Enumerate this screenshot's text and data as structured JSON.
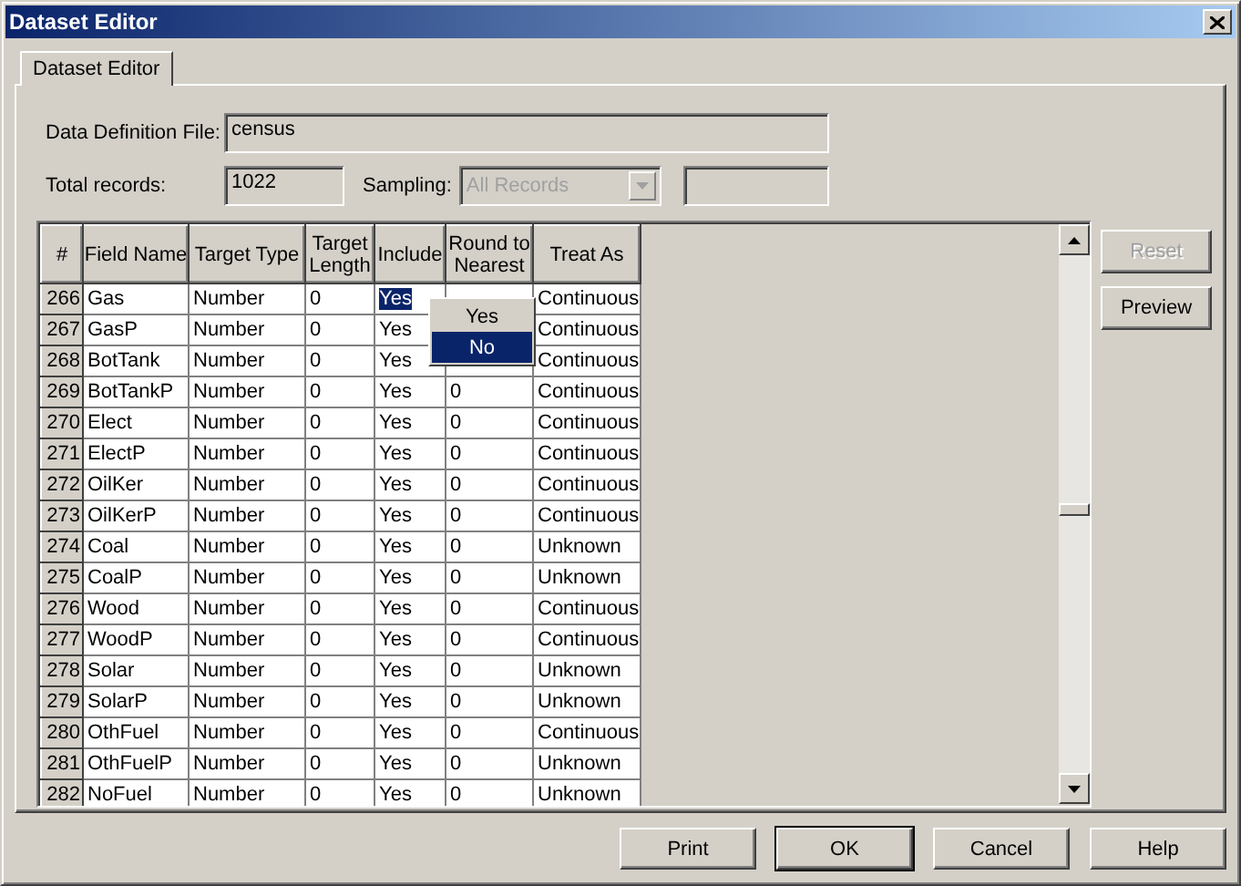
{
  "window": {
    "title": "Dataset Editor"
  },
  "tabs": [
    {
      "label": "Dataset Editor",
      "selected": true
    }
  ],
  "data_definition_file": {
    "label": "Data Definition File:",
    "value": "census"
  },
  "total_records": {
    "label": "Total records:",
    "value": "1022"
  },
  "sampling": {
    "label": "Sampling:",
    "value": "All Records",
    "disabled": true
  },
  "table": {
    "columns": [
      "#",
      "Field Name",
      "Target Type",
      "Target Length",
      "Include",
      "Round to Nearest",
      "Treat As"
    ],
    "rows": [
      {
        "number": "266",
        "field_name": "Gas",
        "target_type": "Number",
        "target_length": "0",
        "include": "Yes",
        "treat_as": "Continuous",
        "editing": true
      },
      {
        "number": "267",
        "field_name": "GasP",
        "target_type": "Number",
        "target_length": "0",
        "include": "Yes",
        "treat_as": "Continuous",
        "editing": false
      },
      {
        "number": "268",
        "field_name": "BotTank",
        "target_type": "Number",
        "target_length": "0",
        "include": "Yes",
        "treat_as": "Continuous",
        "editing": false
      },
      {
        "number": "269",
        "field_name": "BotTankP",
        "target_type": "Number",
        "target_length": "0",
        "include": "Yes",
        "round_to_nearest": "0",
        "treat_as": "Continuous",
        "editing": false
      },
      {
        "number": "270",
        "field_name": "Elect",
        "target_type": "Number",
        "target_length": "0",
        "include": "Yes",
        "round_to_nearest": "0",
        "treat_as": "Continuous",
        "editing": false
      },
      {
        "number": "271",
        "field_name": "ElectP",
        "target_type": "Number",
        "target_length": "0",
        "include": "Yes",
        "round_to_nearest": "0",
        "treat_as": "Continuous",
        "editing": false
      },
      {
        "number": "272",
        "field_name": "OilKer",
        "target_type": "Number",
        "target_length": "0",
        "include": "Yes",
        "round_to_nearest": "0",
        "treat_as": "Continuous",
        "editing": false
      },
      {
        "number": "273",
        "field_name": "OilKerP",
        "target_type": "Number",
        "target_length": "0",
        "include": "Yes",
        "round_to_nearest": "0",
        "treat_as": "Continuous",
        "editing": false
      },
      {
        "number": "274",
        "field_name": "Coal",
        "target_type": "Number",
        "target_length": "0",
        "include": "Yes",
        "round_to_nearest": "0",
        "treat_as": "Unknown",
        "editing": false
      },
      {
        "number": "275",
        "field_name": "CoalP",
        "target_type": "Number",
        "target_length": "0",
        "include": "Yes",
        "round_to_nearest": "0",
        "treat_as": "Unknown",
        "editing": false
      },
      {
        "number": "276",
        "field_name": "Wood",
        "target_type": "Number",
        "target_length": "0",
        "include": "Yes",
        "round_to_nearest": "0",
        "treat_as": "Continuous",
        "editing": false
      },
      {
        "number": "277",
        "field_name": "WoodP",
        "target_type": "Number",
        "target_length": "0",
        "include": "Yes",
        "round_to_nearest": "0",
        "treat_as": "Continuous",
        "editing": false
      },
      {
        "number": "278",
        "field_name": "Solar",
        "target_type": "Number",
        "target_length": "0",
        "include": "Yes",
        "round_to_nearest": "0",
        "treat_as": "Unknown",
        "editing": false
      },
      {
        "number": "279",
        "field_name": "SolarP",
        "target_type": "Number",
        "target_length": "0",
        "include": "Yes",
        "round_to_nearest": "0",
        "treat_as": "Unknown",
        "editing": false
      },
      {
        "number": "280",
        "field_name": "OthFuel",
        "target_type": "Number",
        "target_length": "0",
        "include": "Yes",
        "round_to_nearest": "0",
        "treat_as": "Continuous",
        "editing": false
      },
      {
        "number": "281",
        "field_name": "OthFuelP",
        "target_type": "Number",
        "target_length": "0",
        "include": "Yes",
        "round_to_nearest": "0",
        "treat_as": "Unknown",
        "editing": false
      },
      {
        "number": "282",
        "field_name": "NoFuel",
        "target_type": "Number",
        "target_length": "0",
        "include": "Yes",
        "round_to_nearest": "0",
        "treat_as": "Unknown",
        "editing": false
      }
    ]
  },
  "include_dropdown": {
    "options": [
      {
        "label": "Yes",
        "selected": false
      },
      {
        "label": "No",
        "selected": true
      }
    ]
  },
  "side_buttons": [
    {
      "label": "Reset",
      "disabled": true
    },
    {
      "label": "Preview",
      "disabled": false
    }
  ],
  "buttons": [
    {
      "label": "Print",
      "default": false
    },
    {
      "label": "OK",
      "default": true
    },
    {
      "label": "Cancel",
      "default": false
    },
    {
      "label": "Help",
      "default": false
    }
  ]
}
